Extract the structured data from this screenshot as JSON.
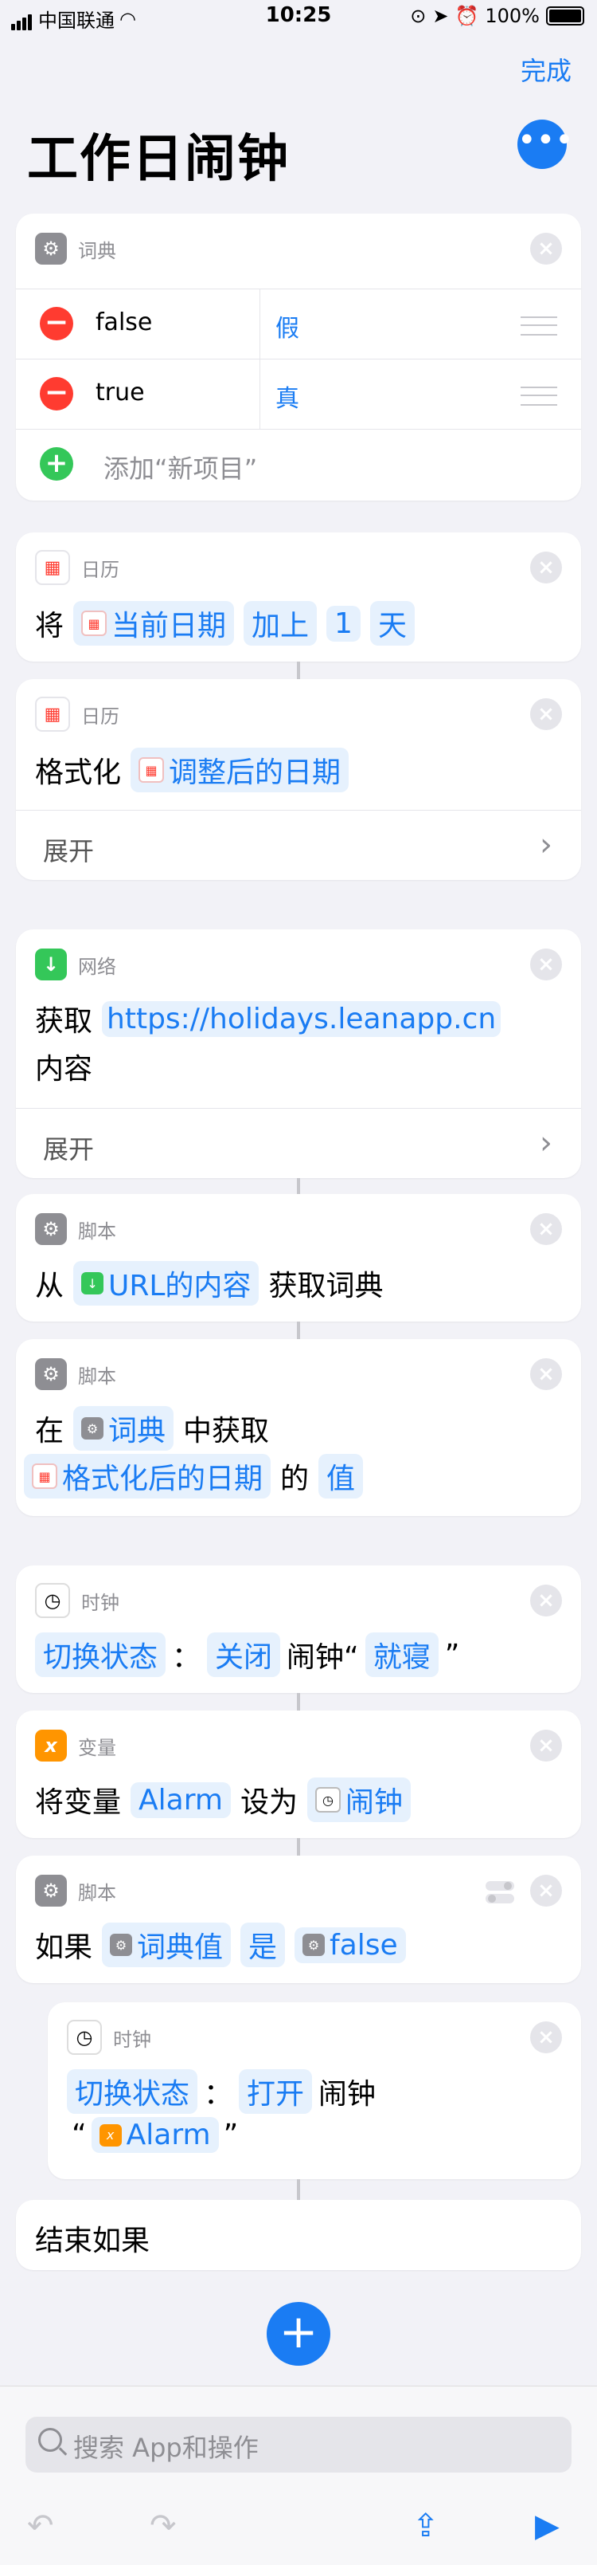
{
  "status": {
    "carrier": "中国联通",
    "time": "10:25",
    "battery": "100%"
  },
  "nav": {
    "done": "完成",
    "title": "工作日闹钟",
    "more": "•••"
  },
  "dict": {
    "header": "词典",
    "rows": [
      {
        "key": "false",
        "value": "假"
      },
      {
        "key": "true",
        "value": "真"
      }
    ],
    "add": "添加“新项目”"
  },
  "a1": {
    "header": "日历",
    "w1": "将",
    "t1": "当前日期",
    "t2": "加上",
    "t3": "1",
    "t4": "天"
  },
  "a2": {
    "header": "日历",
    "w1": "格式化",
    "t1": "调整后的日期",
    "expand": "展开"
  },
  "a3": {
    "header": "网络",
    "w1": "获取",
    "url": "https://holidays.leanapp.cn",
    "w2": "内容",
    "expand": "展开"
  },
  "a4": {
    "header": "脚本",
    "w1": "从",
    "t1": "URL的内容",
    "w2": "获取词典"
  },
  "a5": {
    "header": "脚本",
    "w1": "在",
    "t1": "词典",
    "w2": "中获取",
    "t2": "格式化后的日期",
    "w3": "的",
    "t3": "值"
  },
  "a6": {
    "header": "时钟",
    "t1": "切换状态",
    "w1": "：",
    "t2": "关闭",
    "w2": "闹钟“",
    "t3": "就寝",
    "w3": "”"
  },
  "a7": {
    "header": "变量",
    "w1": "将变量",
    "t1": "Alarm",
    "w2": "设为",
    "t2": "闹钟"
  },
  "a8": {
    "header": "脚本",
    "w1": "如果",
    "t1": "词典值",
    "t2": "是",
    "t3": "false"
  },
  "a9": {
    "header": "时钟",
    "t1": "切换状态",
    "w1": "：",
    "t2": "打开",
    "w2": "闹钟",
    "w3": "“",
    "t3": "Alarm",
    "w4": "”"
  },
  "a10": {
    "text": "结束如果"
  },
  "search": {
    "placeholder": "搜索 App和操作"
  }
}
